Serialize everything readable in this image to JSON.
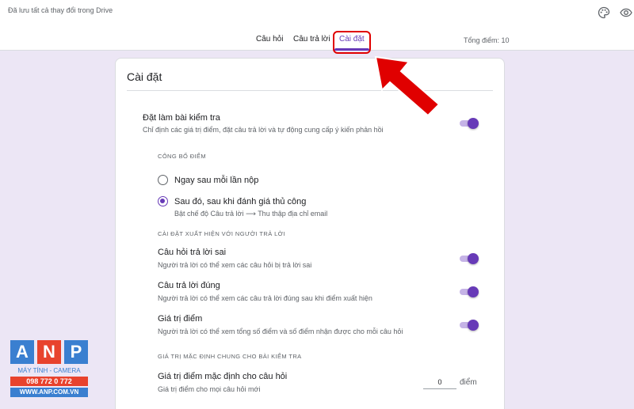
{
  "header": {
    "save_status": "Đã lưu tất cả thay đổi trong Drive",
    "palette_icon": "palette-icon",
    "preview_icon": "eye-icon",
    "total_score": "Tổng điểm: 10"
  },
  "tabs": [
    {
      "label": "Câu hỏi",
      "active": false
    },
    {
      "label": "Câu trả lời",
      "active": false
    },
    {
      "label": "Cài đặt",
      "active": true
    }
  ],
  "settings": {
    "title": "Cài đặt",
    "quiz": {
      "title": "Đặt làm bài kiểm tra",
      "description": "Chỉ định các giá trị điểm, đặt câu trả lời và tự động cung cấp ý kiến phản hồi",
      "enabled": true
    },
    "release_grade": {
      "heading": "CÔNG BỐ ĐIỂM",
      "options": [
        {
          "label": "Ngay sau mỗi lần nộp",
          "description": "",
          "selected": false
        },
        {
          "label": "Sau đó, sau khi đánh giá thủ công",
          "description": "Bật chế độ Câu trả lời ⟶ Thu thập địa chỉ email",
          "selected": true
        }
      ]
    },
    "respondent_view": {
      "heading": "CÀI ĐẶT XUẤT HIỆN VỚI NGƯỜI TRẢ LỜI",
      "items": [
        {
          "title": "Câu hỏi trả lời sai",
          "description": "Người trả lời có thể xem các câu hỏi bị trả lời sai",
          "enabled": true
        },
        {
          "title": "Câu trả lời đúng",
          "description": "Người trả lời có thể xem các câu trả lời đúng sau khi điểm xuất hiện",
          "enabled": true
        },
        {
          "title": "Giá trị điểm",
          "description": "Người trả lời có thể xem tổng số điểm và số điểm nhận được cho mỗi câu hỏi",
          "enabled": true
        }
      ]
    },
    "defaults": {
      "heading": "GIÁ TRỊ MẶC ĐỊNH CHUNG CHO BÀI KIỂM TRA",
      "points_title": "Giá trị điểm mặc định cho câu hỏi",
      "points_description": "Giá trị điểm cho mọi câu hỏi mới",
      "points_value": "0",
      "points_unit": "điểm"
    }
  },
  "colors": {
    "accent": "#673ab7",
    "background": "#ece6f5",
    "highlight": "#e00000"
  },
  "watermark": {
    "letters": [
      "A",
      "N",
      "P"
    ],
    "line1": "MÁY TÍNH - CAMERA",
    "line2": "098 772 0 772",
    "line3": "WWW.ANP.COM.VN"
  }
}
